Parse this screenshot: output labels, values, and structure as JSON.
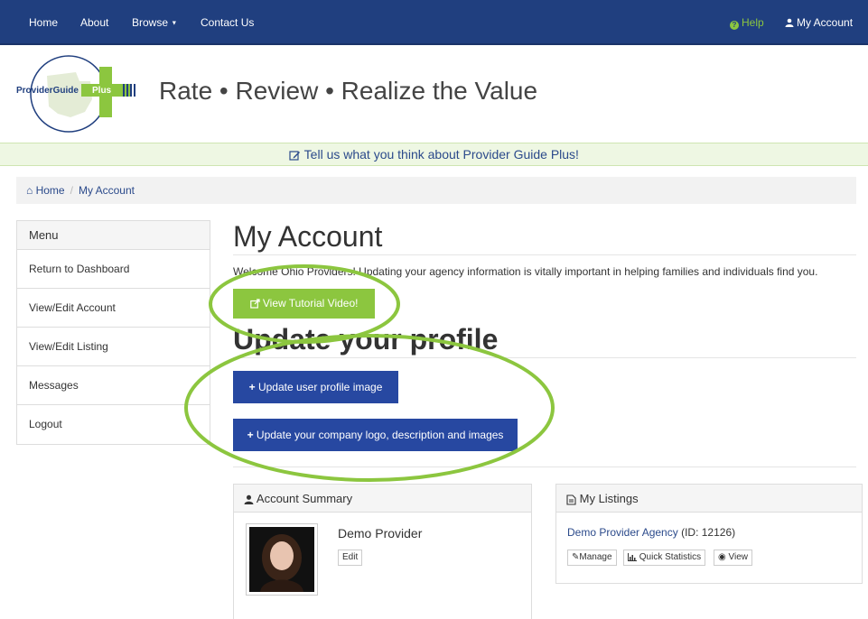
{
  "nav": {
    "home": "Home",
    "about": "About",
    "browse": "Browse",
    "contact": "Contact Us",
    "help": "Help",
    "my_account": "My Account"
  },
  "header": {
    "logo_text_1": "ProviderGuide",
    "logo_text_2": "Plus",
    "tagline": "Rate • Review • Realize the Value"
  },
  "feedback": "Tell us what you think about Provider Guide Plus!",
  "breadcrumb": {
    "home": "Home",
    "current": "My Account"
  },
  "menu": {
    "title": "Menu",
    "items": [
      {
        "label": "Return to Dashboard"
      },
      {
        "label": "View/Edit Account"
      },
      {
        "label": "View/Edit Listing"
      },
      {
        "label": "Messages"
      },
      {
        "label": "Logout"
      }
    ]
  },
  "main": {
    "title": "My Account",
    "welcome": "Welcome Ohio Providers! Updating your agency information is vitally important in helping families and individuals find you.",
    "tutorial_button": "View Tutorial Video!",
    "section_title": "Update your profile",
    "update_image_button": "Update user profile image",
    "update_company_button": "Update your company logo, description and images"
  },
  "account_summary": {
    "title": "Account Summary",
    "name": "Demo Provider",
    "edit": "Edit"
  },
  "my_listings": {
    "title": "My Listings",
    "listing_name": "Demo Provider Agency",
    "listing_id": "(ID: 12126)",
    "manage": "Manage",
    "stats": "Quick Statistics",
    "view": "View"
  },
  "colors": {
    "nav_bg": "#203f7f",
    "brand_green": "#8cc63f",
    "button_blue": "#2748a1",
    "link_blue": "#2b4a8b"
  }
}
